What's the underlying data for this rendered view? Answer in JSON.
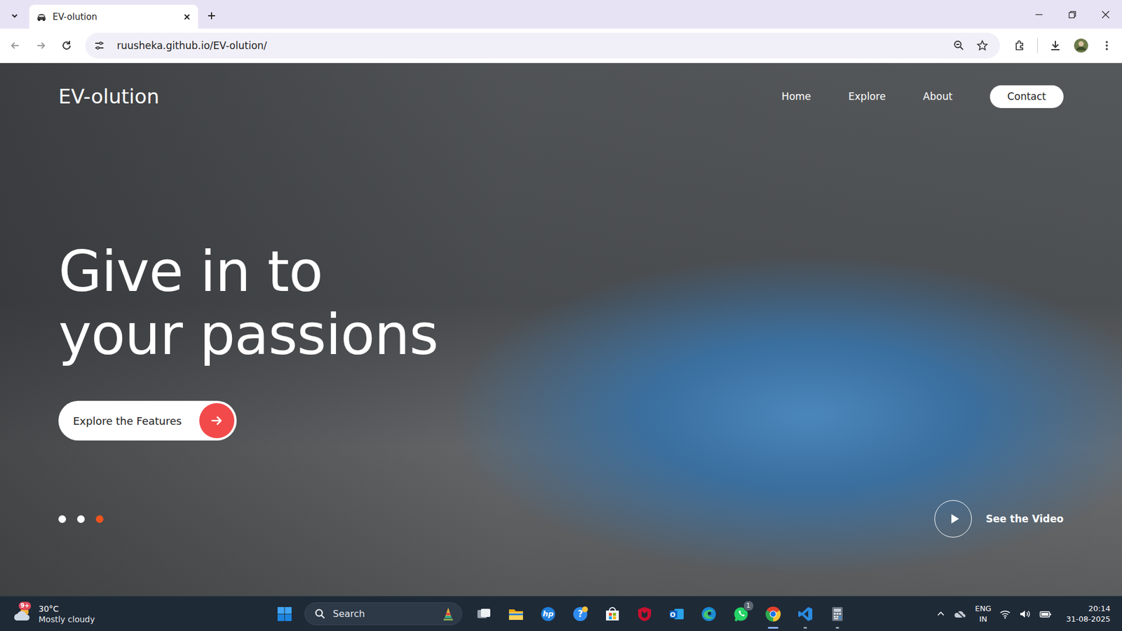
{
  "browser": {
    "tabs": [
      {
        "title": "EV-olution",
        "selected": true
      }
    ],
    "address": "ruusheka.github.io/EV-olution/"
  },
  "page": {
    "logo": "EV-olution",
    "nav": [
      {
        "label": "Home",
        "kind": "link"
      },
      {
        "label": "Explore",
        "kind": "link"
      },
      {
        "label": "About",
        "kind": "link"
      },
      {
        "label": "Contact",
        "kind": "button"
      }
    ],
    "headline": [
      "Give in to",
      "your passions"
    ],
    "cta": {
      "label": "Explore the Features"
    },
    "slides": [
      {
        "selected": false
      },
      {
        "selected": false
      },
      {
        "selected": true
      }
    ],
    "video": {
      "label": "See the Video"
    }
  },
  "taskbar": {
    "weather": {
      "temp": "30°C",
      "summary": "Mostly cloudy",
      "badge": "9+"
    },
    "search": {
      "placeholder": "Search"
    },
    "apps": [
      {
        "kind": "taskview",
        "open": false,
        "active": false
      },
      {
        "kind": "files",
        "open": false,
        "active": false
      },
      {
        "kind": "hp",
        "glyph": "hp",
        "open": false,
        "active": false
      },
      {
        "kind": "help",
        "glyph": "?",
        "open": false,
        "active": false
      },
      {
        "kind": "store",
        "open": false,
        "active": false
      },
      {
        "kind": "mcafee",
        "open": false,
        "active": false
      },
      {
        "kind": "outlook",
        "glyph": "O",
        "open": false,
        "active": false
      },
      {
        "kind": "edge",
        "open": false,
        "active": false
      },
      {
        "kind": "whatsapp",
        "badge": "1",
        "open": false,
        "active": false
      },
      {
        "kind": "chrome",
        "open": true,
        "active": true
      },
      {
        "kind": "vscode",
        "open": true,
        "active": false
      },
      {
        "kind": "calculator",
        "open": true,
        "active": false
      }
    ],
    "tray": {
      "language": "ENG",
      "region": "IN",
      "time": "20:14",
      "date": "31-08-2025"
    }
  }
}
